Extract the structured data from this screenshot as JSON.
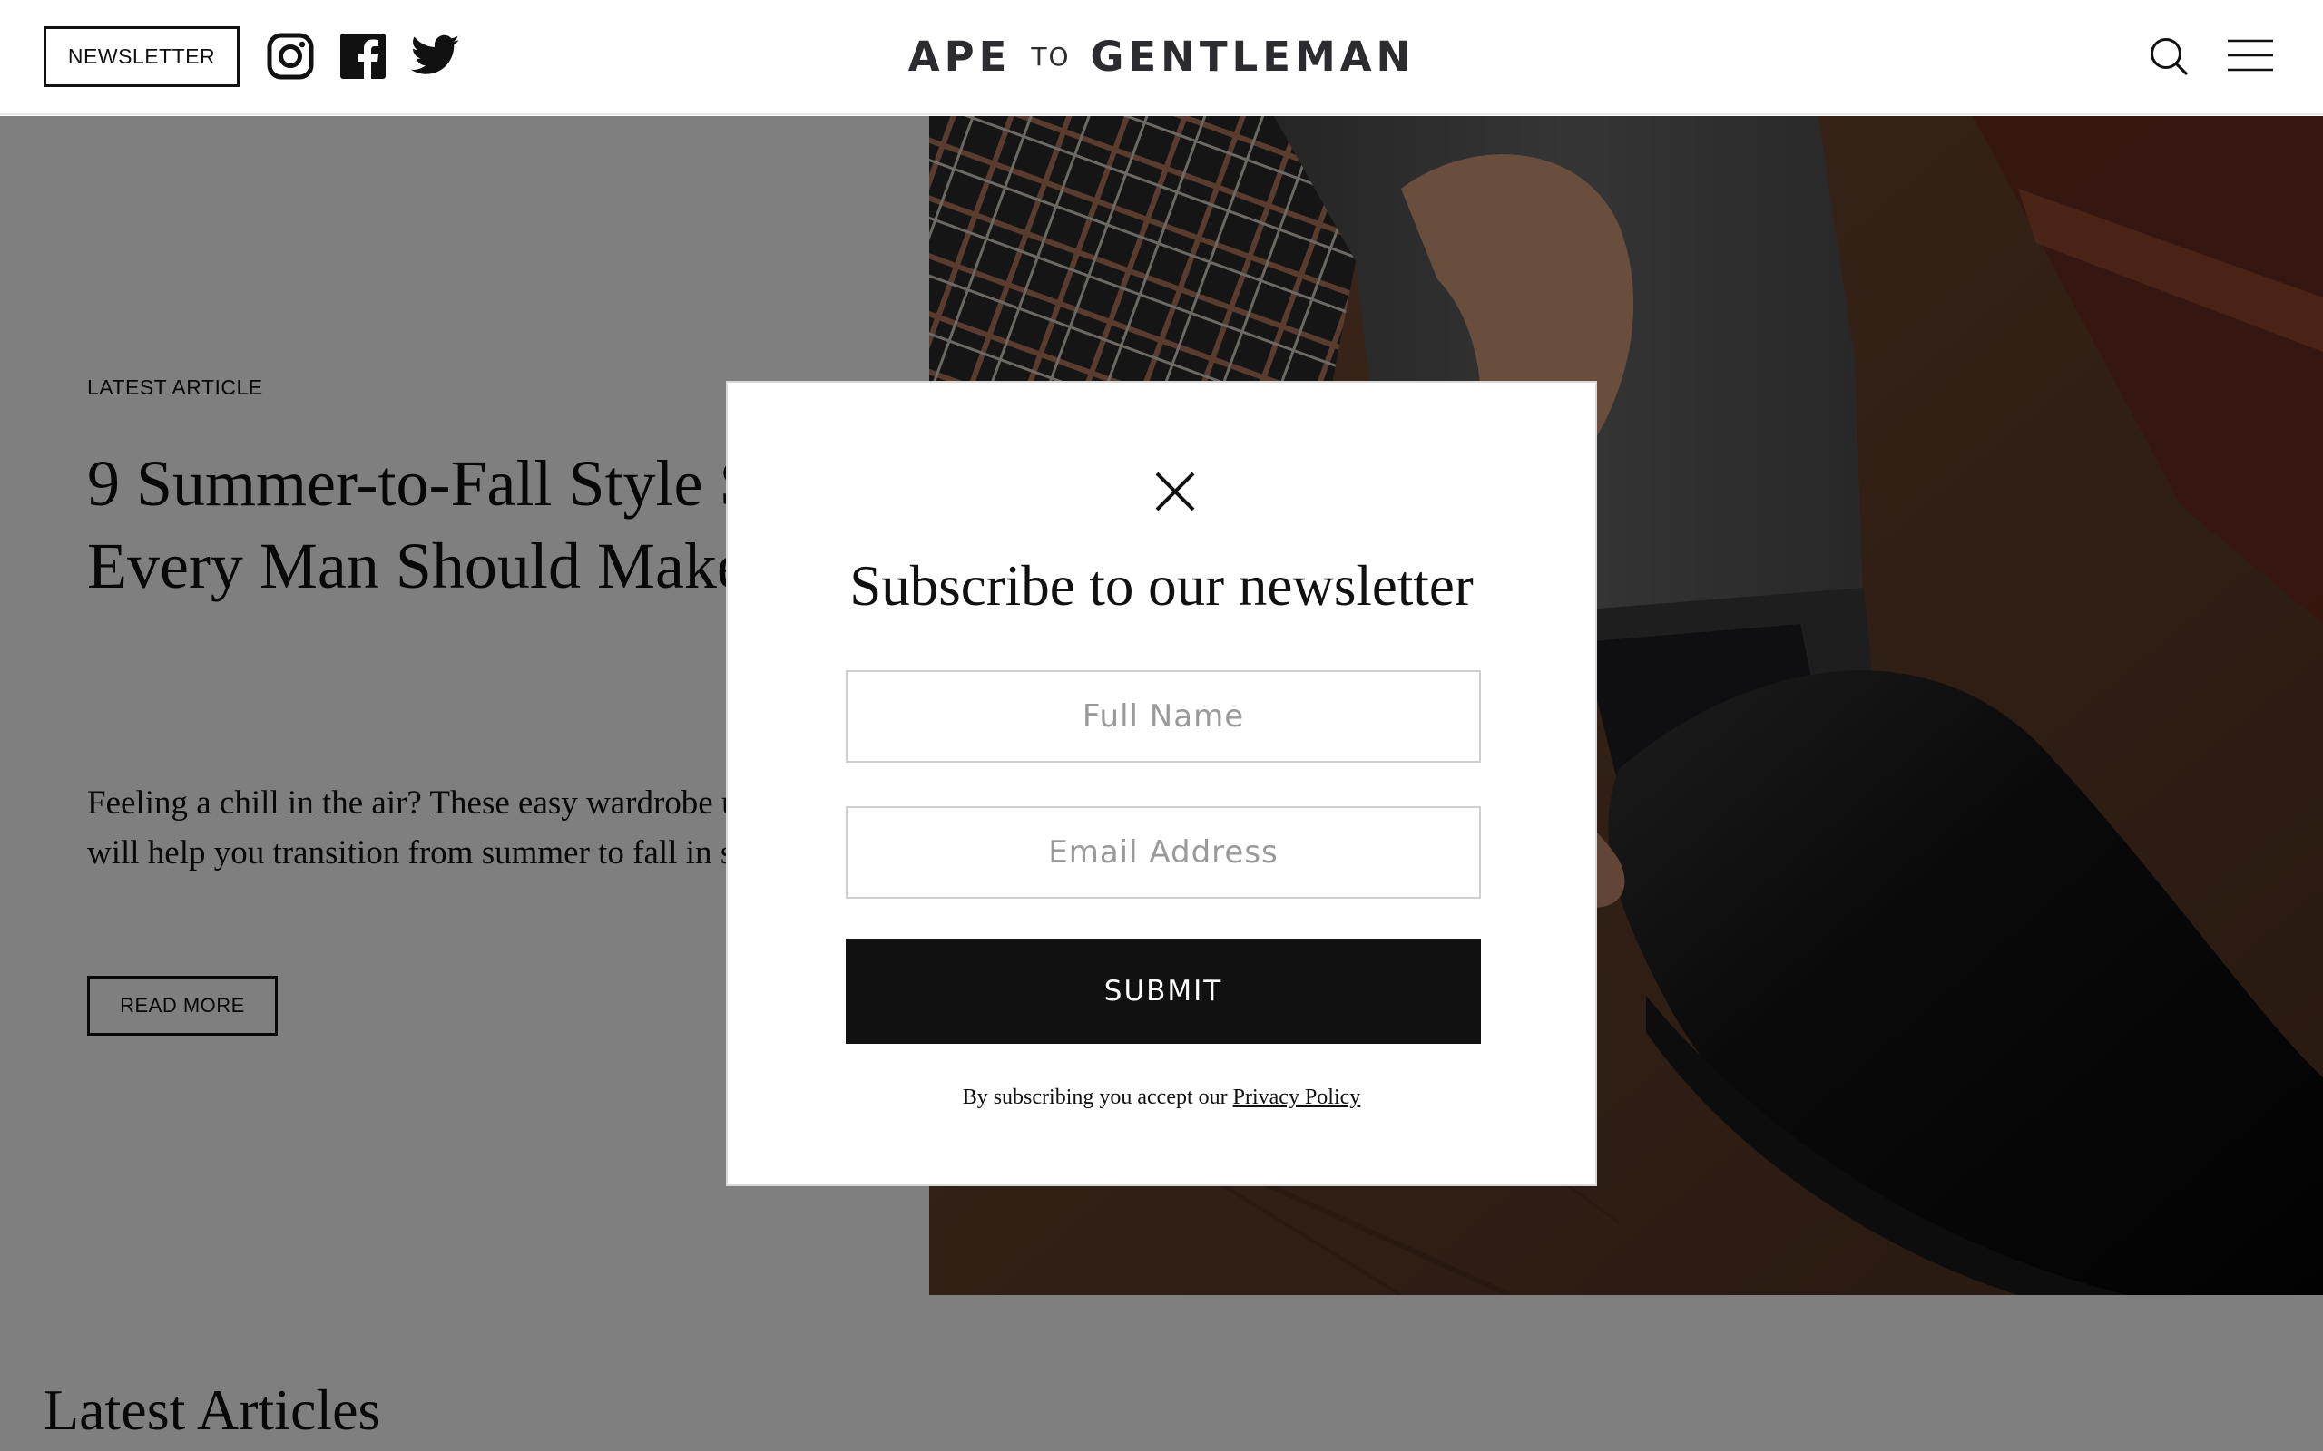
{
  "header": {
    "newsletter_label": "NEWSLETTER",
    "logo": {
      "left": "APE",
      "middle": "TO",
      "right": "GENTLEMAN"
    },
    "social_icons": [
      "instagram-icon",
      "facebook-icon",
      "twitter-icon"
    ]
  },
  "hero": {
    "kicker": "LATEST ARTICLE",
    "title": "9 Summer-to-Fall Style Swaps Every Man Should Make",
    "description": "Feeling a chill in the air? These easy wardrobe updates will help you transition from summer to fall in style.",
    "read_more_label": "READ MORE"
  },
  "latest_articles": {
    "title": "Latest Articles"
  },
  "modal": {
    "title": "Subscribe to our newsletter",
    "full_name_placeholder": "Full Name",
    "email_placeholder": "Email Address",
    "submit_label": "SUBMIT",
    "legal_prefix": "By subscribing you accept our",
    "privacy_link_label": "Privacy Policy"
  },
  "colors": {
    "accent_dark": "#111111",
    "overlay": "rgba(0,0,0,0.5)",
    "logo": "#2b2b30"
  }
}
